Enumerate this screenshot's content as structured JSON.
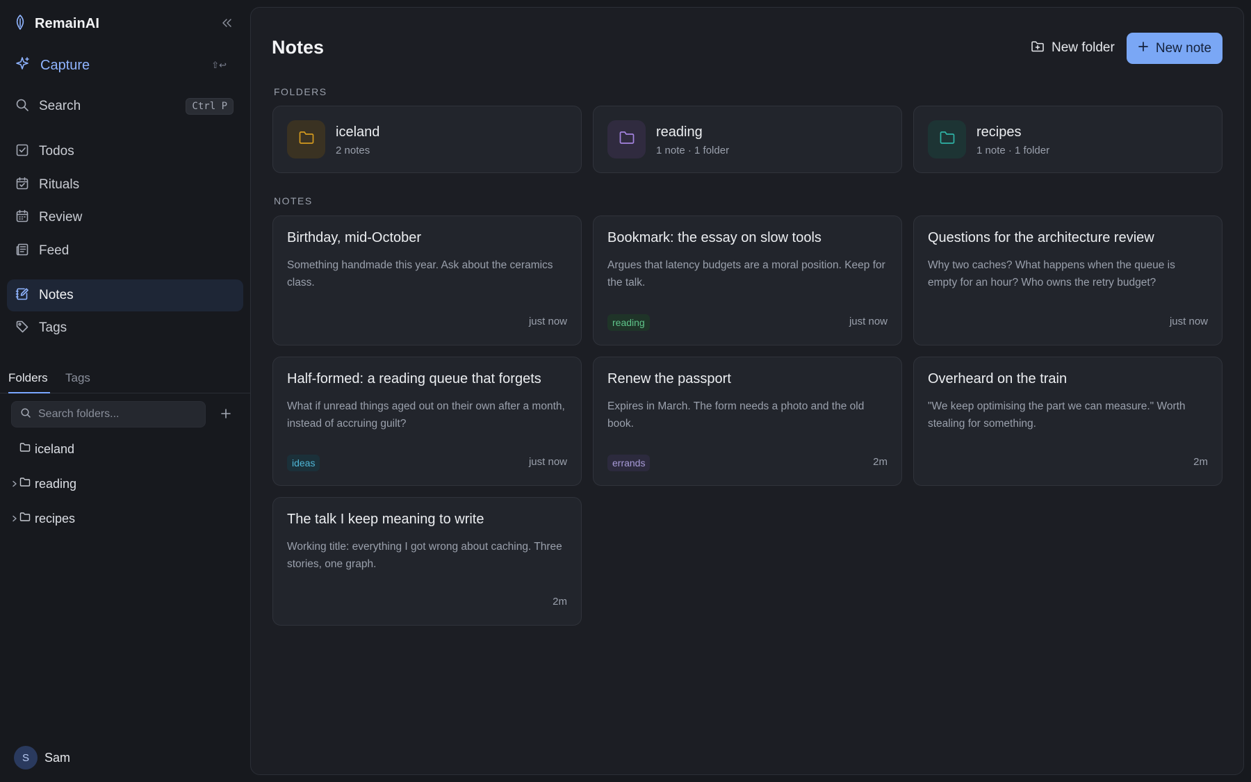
{
  "app": {
    "name": "RemainAI"
  },
  "sidebar": {
    "capture": {
      "label": "Capture",
      "shortcut": "⇧↩"
    },
    "search": {
      "label": "Search",
      "shortcut": "Ctrl P"
    },
    "nav": [
      {
        "label": "Todos",
        "icon": "checkbox-icon"
      },
      {
        "label": "Rituals",
        "icon": "calendar-check-icon"
      },
      {
        "label": "Review",
        "icon": "calendar-icon"
      },
      {
        "label": "Feed",
        "icon": "newspaper-icon"
      },
      {
        "label": "Notes",
        "icon": "notebook-pen-icon",
        "active": true
      },
      {
        "label": "Tags",
        "icon": "tag-icon"
      }
    ],
    "tabs": {
      "folders": "Folders",
      "tags": "Tags"
    },
    "folder_search": {
      "placeholder": "Search folders..."
    },
    "tree": [
      {
        "label": "iceland"
      },
      {
        "label": "reading"
      },
      {
        "label": "recipes"
      }
    ],
    "user": {
      "initial": "S",
      "name": "Sam"
    }
  },
  "main": {
    "title": "Notes",
    "new_folder_label": "New folder",
    "new_note_label": "New note",
    "folders_heading": "FOLDERS",
    "notes_heading": "NOTES",
    "folders": [
      {
        "name": "iceland",
        "meta": "2 notes",
        "color": "#d39a1f"
      },
      {
        "name": "reading",
        "meta": "1 note · 1 folder",
        "color": "#a484e0"
      },
      {
        "name": "recipes",
        "meta": "1 note · 1 folder",
        "color": "#2fb3a6"
      }
    ],
    "notes": [
      {
        "title": "Birthday, mid-October",
        "body": "Something handmade this year. Ask about the ceramics class.",
        "time": "just now",
        "tag": ""
      },
      {
        "title": "Bookmark: the essay on slow tools",
        "body": "Argues that latency budgets are a moral position. Keep for the talk.",
        "time": "just now",
        "tag": "reading"
      },
      {
        "title": "Questions for the architecture review",
        "body": "Why two caches? What happens when the queue is empty for an hour? Who owns the retry budget?",
        "time": "just now",
        "tag": ""
      },
      {
        "title": "Half-formed: a reading queue that forgets",
        "body": "What if unread things aged out on their own after a month, instead of accruing guilt?",
        "time": "just now",
        "tag": "ideas"
      },
      {
        "title": "Renew the passport",
        "body": "Expires in March. The form needs a photo and the old book.",
        "time": "2m",
        "tag": "errands"
      },
      {
        "title": "Overheard on the train",
        "body": "\"We keep optimising the part we can measure.\" Worth stealing for something.",
        "time": "2m",
        "tag": ""
      },
      {
        "title": "The talk I keep meaning to write",
        "body": "Working title: everything I got wrong about caching. Three stories, one graph.",
        "time": "2m",
        "tag": ""
      }
    ],
    "tag_colors": {
      "reading": {
        "fg": "#5fc48a",
        "bg": "#1f3428"
      },
      "ideas": {
        "fg": "#4fb6d6",
        "bg": "#1b3039"
      },
      "errands": {
        "fg": "#a89bd8",
        "bg": "#2c2a3d"
      }
    }
  }
}
